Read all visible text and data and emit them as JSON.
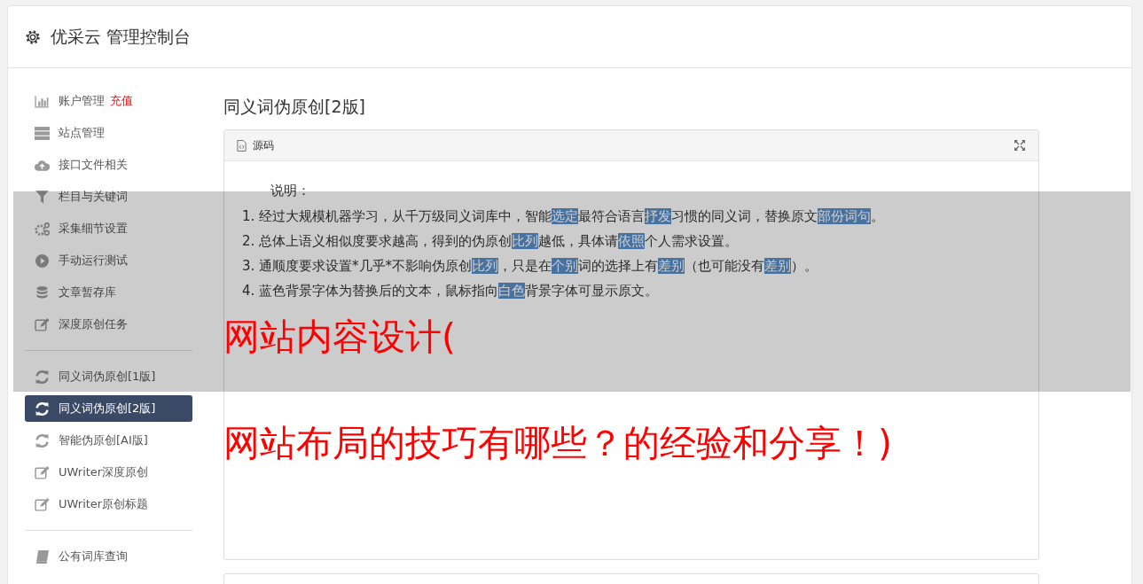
{
  "header": {
    "title": "优采云 管理控制台"
  },
  "sidebar": {
    "groups": [
      [
        {
          "label": "账户管理",
          "kind": "chart",
          "badge": "充值",
          "selected": false
        },
        {
          "label": "站点管理",
          "kind": "server",
          "selected": false
        },
        {
          "label": "接口文件相关",
          "kind": "cloud",
          "selected": false
        },
        {
          "label": "栏目与关键词",
          "kind": "filter",
          "selected": false
        },
        {
          "label": "采集细节设置",
          "kind": "cogs",
          "selected": false
        },
        {
          "label": "手动运行测试",
          "kind": "play",
          "selected": false
        },
        {
          "label": "文章暂存库",
          "kind": "database",
          "selected": false
        },
        {
          "label": "深度原创任务",
          "kind": "edit",
          "selected": false
        }
      ],
      [
        {
          "label": "同义词伪原创[1版]",
          "kind": "refresh",
          "selected": false
        },
        {
          "label": "同义词伪原创[2版]",
          "kind": "refresh",
          "selected": true
        },
        {
          "label": "智能伪原创[AI版]",
          "kind": "refresh",
          "selected": false
        },
        {
          "label": "UWriter深度原创",
          "kind": "edit",
          "selected": false
        },
        {
          "label": "UWriter原创标题",
          "kind": "edit",
          "selected": false
        }
      ],
      [
        {
          "label": "公有词库查询",
          "kind": "book",
          "selected": false
        }
      ]
    ]
  },
  "page_title": "同义词伪原创[2版]",
  "panel": {
    "tab": "源码",
    "intro": "说明：",
    "lines": [
      [
        {
          "text": "1. 经过大规模机器学习，从千万级同义词库中，智能",
          "highlighted": false
        },
        {
          "text": "选定",
          "highlighted": true
        },
        {
          "text": "最符合语言",
          "highlighted": false
        },
        {
          "text": "抒发",
          "highlighted": true
        },
        {
          "text": "习惯的同义词，替换原文",
          "highlighted": false
        },
        {
          "text": "部份",
          "highlighted": true
        },
        {
          "text": "词句",
          "highlighted": true
        },
        {
          "text": "。",
          "highlighted": false
        }
      ],
      [
        {
          "text": "2. 总体上语义相似度要求越高，得到的伪原创",
          "highlighted": false
        },
        {
          "text": "比列",
          "highlighted": true
        },
        {
          "text": "越低，具体请",
          "highlighted": false
        },
        {
          "text": "依照",
          "highlighted": true
        },
        {
          "text": "个人需求设置。",
          "highlighted": false
        }
      ],
      [
        {
          "text": "3. 通顺度要求设置*几乎*不影响伪原创",
          "highlighted": false
        },
        {
          "text": "比列",
          "highlighted": true
        },
        {
          "text": "，只是在",
          "highlighted": false
        },
        {
          "text": "个别",
          "highlighted": true
        },
        {
          "text": "词的选择上有",
          "highlighted": false
        },
        {
          "text": "差别",
          "highlighted": true
        },
        {
          "text": "（也可能没有",
          "highlighted": false
        },
        {
          "text": "差别",
          "highlighted": true
        },
        {
          "text": "）。",
          "highlighted": false
        }
      ],
      [
        {
          "text": "4. 蓝色背景字体为替换后的文本，鼠标指向",
          "highlighted": false
        },
        {
          "text": "白色",
          "highlighted": true
        },
        {
          "text": "背景字体可显示原文。",
          "highlighted": false
        }
      ]
    ]
  },
  "overlay_title": {
    "lines": [
      "网站内容设计(",
      "网站布局的技巧有哪些？的经验和分享！)"
    ]
  }
}
